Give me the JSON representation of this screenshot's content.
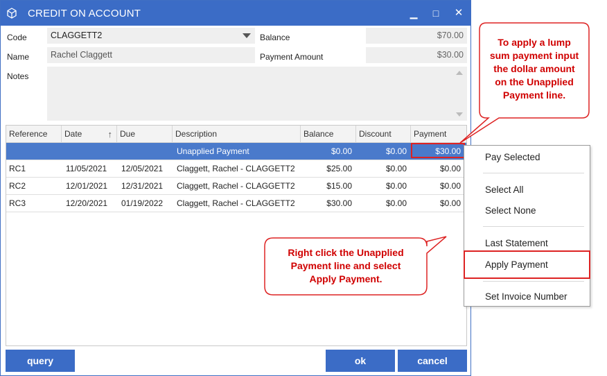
{
  "window": {
    "title": "CREDIT ON ACCOUNT",
    "minimize_glyph": "▁",
    "maximize_glyph": "□",
    "close_glyph": "✕"
  },
  "form": {
    "code_label": "Code",
    "code_value": "CLAGGETT2",
    "name_label": "Name",
    "name_value": "Rachel Claggett",
    "notes_label": "Notes",
    "balance_label": "Balance",
    "balance_value": "$70.00",
    "payment_amount_label": "Payment Amount",
    "payment_amount_value": "$30.00"
  },
  "grid": {
    "columns": [
      "Reference",
      "Date",
      "Due",
      "Description",
      "Balance",
      "Discount",
      "Payment"
    ],
    "rows": [
      {
        "reference": "",
        "date": "",
        "due": "",
        "description": "Unapplied Payment",
        "balance": "$0.00",
        "discount": "$0.00",
        "payment": "$30.00",
        "selected": true
      },
      {
        "reference": "RC1",
        "date": "11/05/2021",
        "due": "12/05/2021",
        "description": "Claggett, Rachel - CLAGGETT2",
        "balance": "$25.00",
        "discount": "$0.00",
        "payment": "$0.00"
      },
      {
        "reference": "RC2",
        "date": "12/01/2021",
        "due": "12/31/2021",
        "description": "Claggett, Rachel - CLAGGETT2",
        "balance": "$15.00",
        "discount": "$0.00",
        "payment": "$0.00"
      },
      {
        "reference": "RC3",
        "date": "12/20/2021",
        "due": "01/19/2022",
        "description": "Claggett, Rachel - CLAGGETT2",
        "balance": "$30.00",
        "discount": "$0.00",
        "payment": "$0.00"
      }
    ]
  },
  "buttons": {
    "query": "query",
    "ok": "ok",
    "cancel": "cancel"
  },
  "context_menu": {
    "pay_selected": "Pay Selected",
    "select_all": "Select All",
    "select_none": "Select None",
    "last_statement": "Last Statement",
    "apply_payment": "Apply Payment",
    "set_invoice_number": "Set Invoice Number"
  },
  "callouts": {
    "top_right": [
      "To apply a lump",
      "sum payment input",
      "the dollar amount",
      "on the Unapplied",
      "Payment line."
    ],
    "middle": [
      "Right click the Unapplied",
      "Payment line and select",
      "Apply Payment."
    ]
  },
  "colors": {
    "accent": "#3b6cc6",
    "selected_row": "#4a7acb",
    "callout_red": "#d00000"
  }
}
